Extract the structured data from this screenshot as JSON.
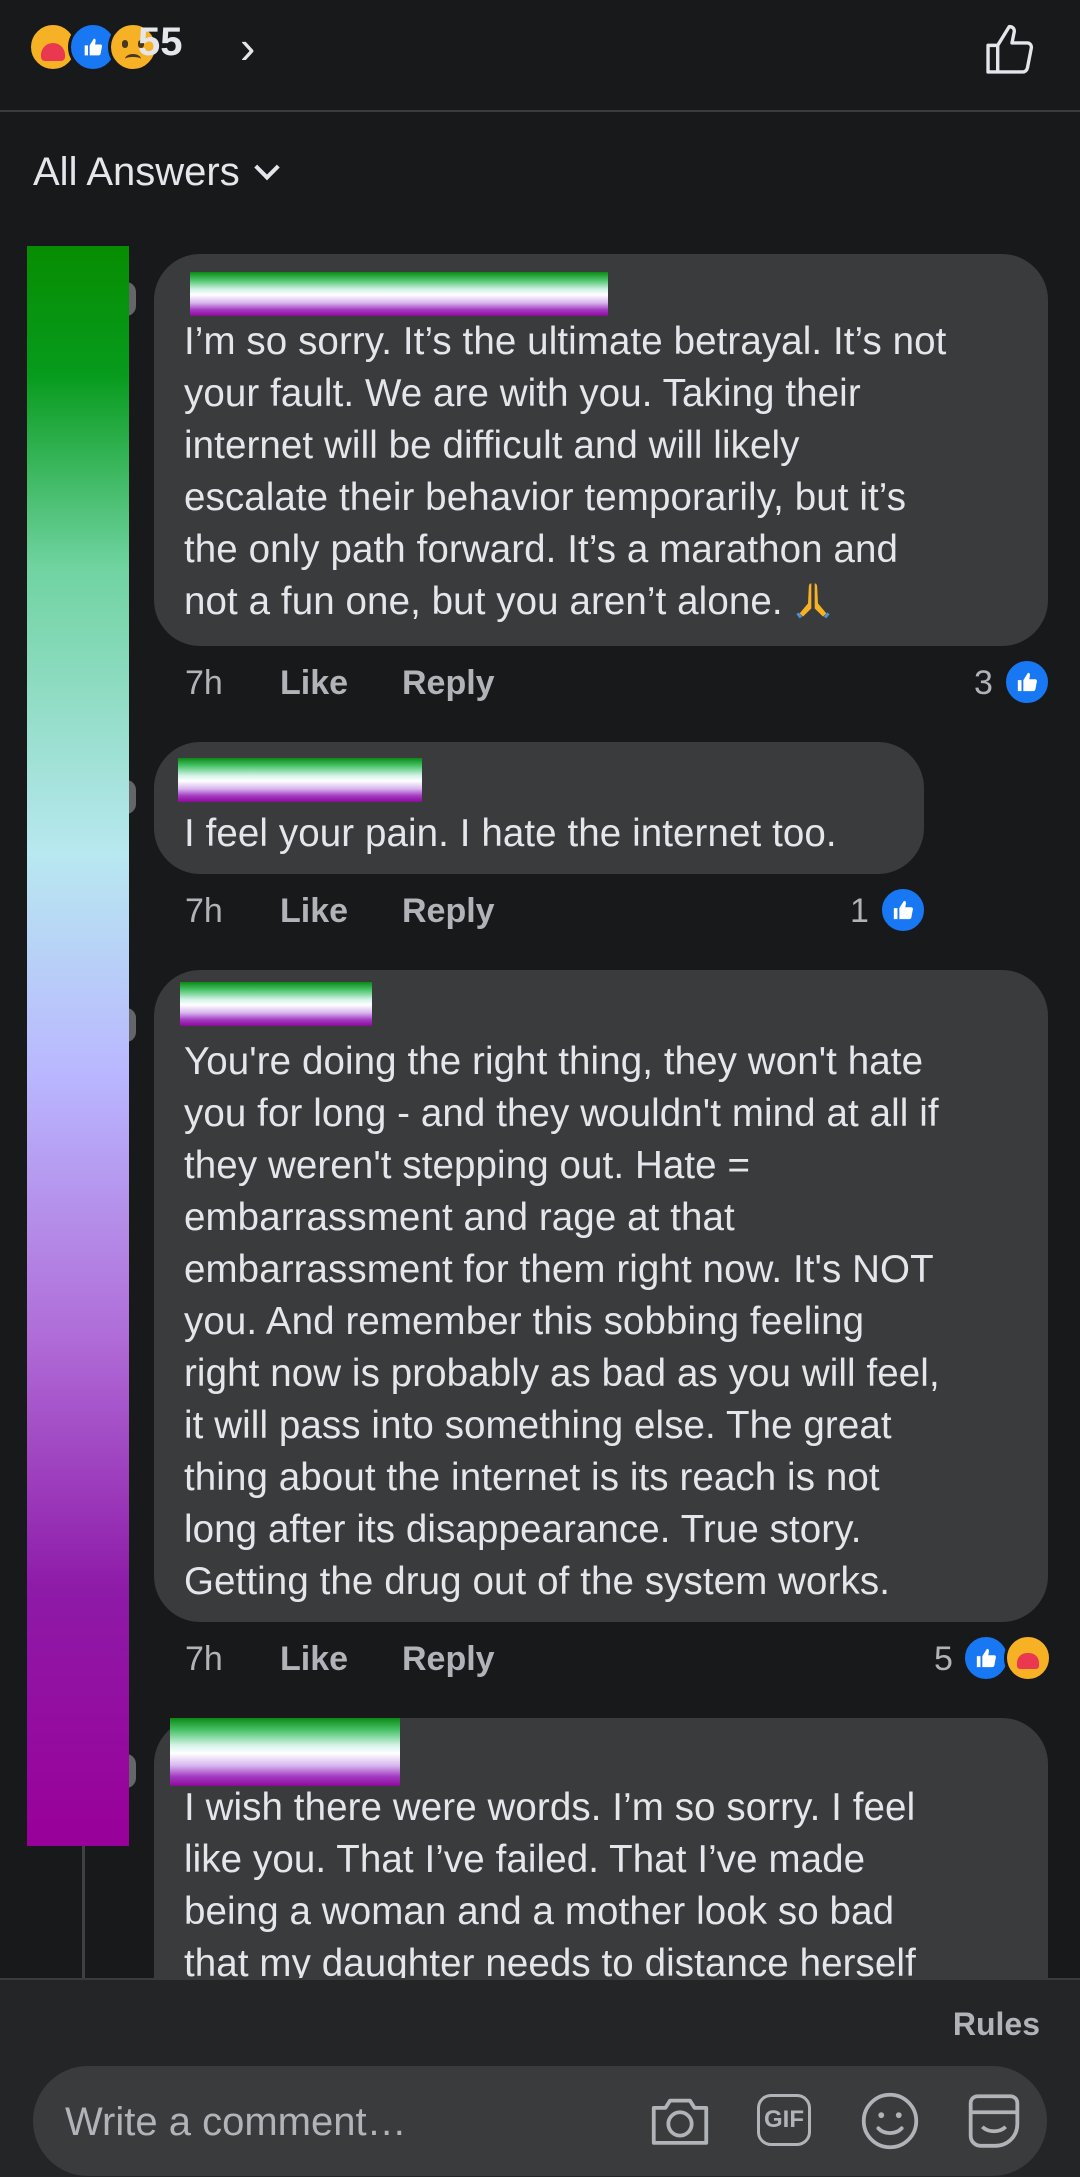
{
  "header": {
    "reaction_count": "55",
    "reactions": [
      "care-icon",
      "like-icon",
      "sad-icon"
    ]
  },
  "sort": {
    "label": "All Answers"
  },
  "comments": [
    {
      "text": "I’m so sorry. It’s the ultimate betrayal. It’s not\nyour fault. We are with you. Taking their\ninternet will be difficult and will likely\nescalate their behavior temporarily, but it’s\nthe only path forward. It’s a marathon and\nnot a fun one, but you aren’t alone.",
      "emoji": "folded-hands-icon",
      "time": "7h",
      "like": "Like",
      "reply": "Reply",
      "reactions_count": "3"
    },
    {
      "text": "I feel your pain. I hate the internet too.",
      "time": "7h",
      "like": "Like",
      "reply": "Reply",
      "reactions_count": "1"
    },
    {
      "text": "You're doing the right thing, they won't hate\nyou for long - and they wouldn't mind at all if\nthey weren't stepping out.  Hate =\nembarrassment and rage at that\nembarrassment for them right now.  It's NOT\nyou.  And remember this sobbing feeling\nright now is probably as bad as you will feel,\nit will pass into something else.  The great\nthing about the internet is its reach is not\nlong after its disappearance.  True story.\nGetting the drug out of the system works.",
      "time": "7h",
      "like": "Like",
      "reply": "Reply",
      "reactions_count": "5"
    },
    {
      "text": "I wish there were words. I’m so sorry. I feel\nlike you. That I’ve failed. That I’ve made\nbeing a woman and a mother look so bad\nthat my daughter needs to distance herself"
    }
  ],
  "footer": {
    "rules_label": "Rules",
    "composer_placeholder": "Write a comment…",
    "icons": [
      "camera-icon",
      "gif-icon",
      "emoji-icon",
      "sticker-icon"
    ],
    "gif_label": "GIF"
  },
  "colors": {
    "background": "#18191a",
    "bubble": "#3a3b3c",
    "like_blue": "#1877f2",
    "muted_text": "#b0b3b8"
  }
}
